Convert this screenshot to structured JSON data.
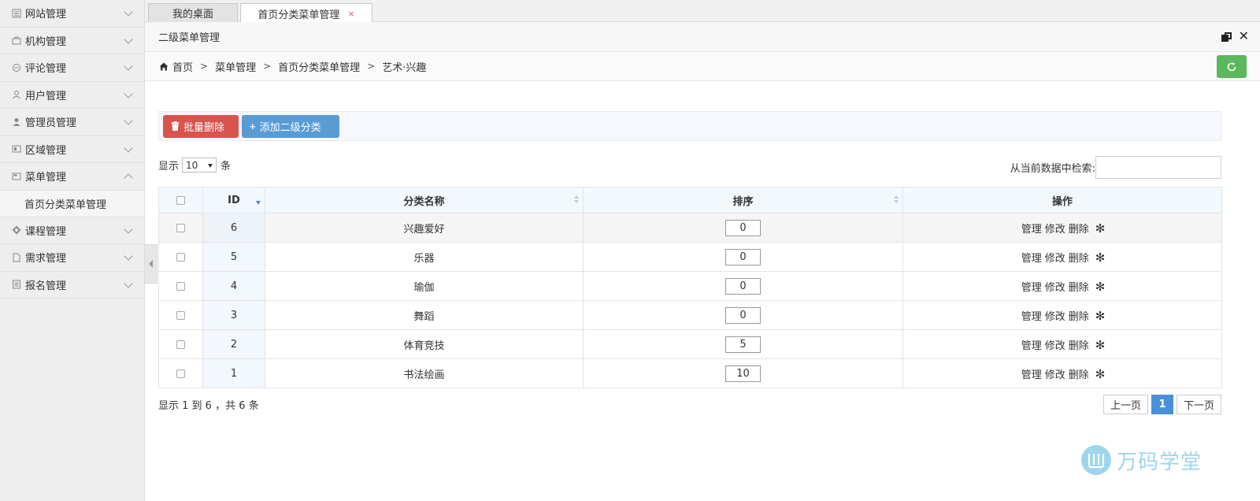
{
  "sidebar": {
    "items": [
      {
        "label": "网站管理",
        "icon": "website-icon",
        "expanded": false
      },
      {
        "label": "机构管理",
        "icon": "briefcase-icon",
        "expanded": false
      },
      {
        "label": "评论管理",
        "icon": "comment-icon",
        "expanded": false
      },
      {
        "label": "用户管理",
        "icon": "user-outline-icon",
        "expanded": false
      },
      {
        "label": "管理员管理",
        "icon": "user-solid-icon",
        "expanded": false
      },
      {
        "label": "区域管理",
        "icon": "region-icon",
        "expanded": false
      },
      {
        "label": "菜单管理",
        "icon": "menu-icon",
        "expanded": true
      },
      {
        "label": "课程管理",
        "icon": "gear-icon",
        "expanded": false
      },
      {
        "label": "需求管理",
        "icon": "document-icon",
        "expanded": false
      },
      {
        "label": "报名管理",
        "icon": "list-icon",
        "expanded": false
      }
    ],
    "submenu": {
      "label": "首页分类菜单管理"
    }
  },
  "tabs": [
    {
      "label": "我的桌面"
    },
    {
      "label": "首页分类菜单管理",
      "close": "×"
    }
  ],
  "panel": {
    "title": "二级菜单管理",
    "close": "✕"
  },
  "breadcrumb": {
    "items": [
      "首页",
      "菜单管理",
      "首页分类菜单管理",
      "艺术·兴趣"
    ],
    "separator": ">"
  },
  "toolbar": {
    "batch_delete_label": "批量删除",
    "add_label": "添加二级分类"
  },
  "length": {
    "prefix": "显示",
    "value": "10",
    "suffix": "条"
  },
  "filter": {
    "label": "从当前数据中检索:",
    "value": ""
  },
  "table": {
    "headers": {
      "id": "ID",
      "name": "分类名称",
      "order": "排序",
      "ops": "操作"
    },
    "rows": [
      {
        "id": "6",
        "name": "兴趣爱好",
        "order": "0"
      },
      {
        "id": "5",
        "name": "乐器",
        "order": "0"
      },
      {
        "id": "4",
        "name": "瑜伽",
        "order": "0"
      },
      {
        "id": "3",
        "name": "舞蹈",
        "order": "0"
      },
      {
        "id": "2",
        "name": "体育竞技",
        "order": "5"
      },
      {
        "id": "1",
        "name": "书法绘画",
        "order": "10"
      }
    ],
    "ops": {
      "manage": "管理",
      "edit": "修改",
      "delete": "删除",
      "star": "✻"
    }
  },
  "info": "显示 1 到 6 ，共 6 条",
  "pagination": {
    "prev": "上一页",
    "current": "1",
    "next": "下一页"
  },
  "watermark": {
    "text": "万码学堂"
  },
  "colors": {
    "danger": "#d9534f",
    "primary": "#5b9bd5",
    "success": "#5cb85c",
    "active_page": "#4a90d9"
  }
}
